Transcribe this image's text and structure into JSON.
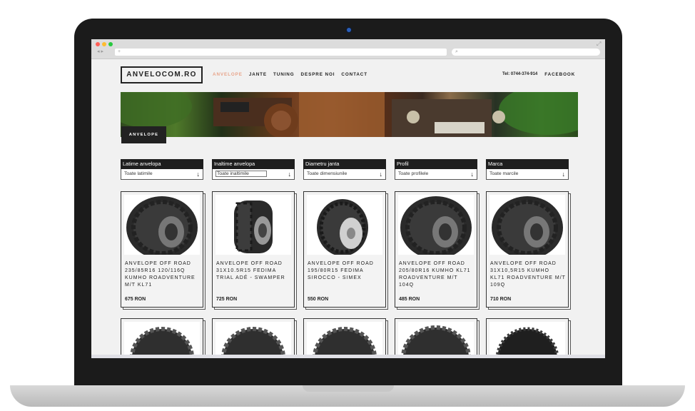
{
  "browser": {
    "url": "",
    "search_placeholder": "",
    "traffic_lights": [
      "#ff5f57",
      "#febc2e",
      "#28c840"
    ]
  },
  "site": {
    "logo": "ANVELOCOM.RO",
    "menu": [
      "ANVELOPE",
      "JANTE",
      "TUNING",
      "DESPRE NOI",
      "CONTACT"
    ],
    "phone": "Tel: 0744-374-914",
    "facebook": "FACEBOOK",
    "hero_tag": "ANVELOPE",
    "accent_color": "#e8a48a"
  },
  "filters": [
    {
      "label": "Latime anvelopa",
      "value": "Toate latimile"
    },
    {
      "label": "Inaltime anvelopa",
      "value": "Toate inaltimile"
    },
    {
      "label": "Diametru janta",
      "value": "Toate dimensiunile"
    },
    {
      "label": "Profil",
      "value": "Toate profilele"
    },
    {
      "label": "Marca",
      "value": "Toate marcile"
    }
  ],
  "products": [
    {
      "name": "ANVELOPE OFF ROAD 235/85R16 120/116Q KUMHO ROADVENTURE M/T KL71",
      "price": "675 RON",
      "icon": "tire-icon"
    },
    {
      "name": "ANVELOPE OFF ROAD 31X10.5R15 FEDIMA TRIAL ADÉ - SWAMPER",
      "price": "725 RON",
      "icon": "tire-icon"
    },
    {
      "name": "ANVELOPE OFF ROAD 195/80R15 FEDIMA SIROCCO - SIMEX",
      "price": "550 RON",
      "icon": "tire-icon"
    },
    {
      "name": "ANVELOPE OFF ROAD 205/80R16 KUMHO KL71 ROADVENTURE M/T 104Q",
      "price": "485 RON",
      "icon": "tire-icon"
    },
    {
      "name": "ANVELOPE OFF ROAD 31X10,5R15 KUMHO KL71 ROADVENTURE M/T 109Q",
      "price": "710 RON",
      "icon": "tire-icon"
    }
  ]
}
